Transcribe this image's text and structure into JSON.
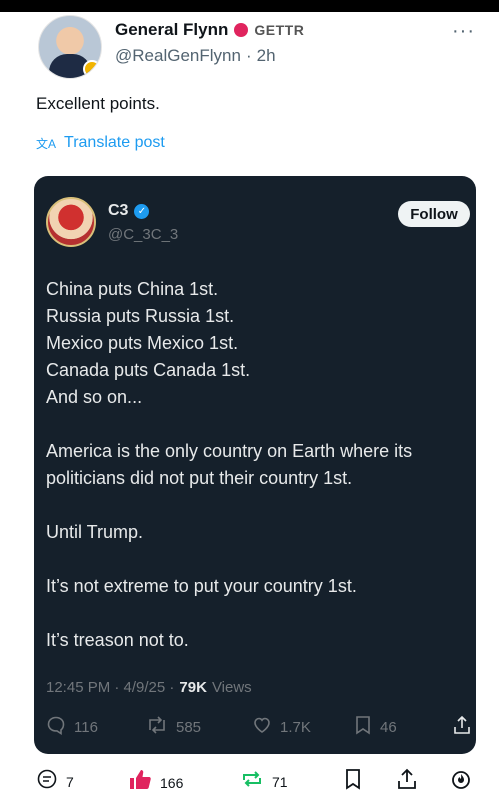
{
  "author": {
    "display_name": "General Flynn",
    "platform_label": "GETTR",
    "handle": "@RealGenFlynn",
    "separator": "·",
    "time": "2h"
  },
  "post": {
    "text": "Excellent points.",
    "translate_label": "Translate post"
  },
  "quoted": {
    "display_name": "C3",
    "handle": "@C_3C_3",
    "follow_label": "Follow",
    "lines": [
      "China puts China 1st.",
      "Russia puts Russia 1st.",
      "Mexico puts Mexico 1st.",
      "Canada puts Canada 1st.",
      "And so on...",
      "",
      "America is the only country on Earth where its",
      "politicians did not put their country 1st.",
      "",
      "Until Trump.",
      "",
      "It’s not extreme to put your country 1st.",
      "",
      "It’s treason not to."
    ],
    "timestamp": "12:45 PM · 4/9/25 ·",
    "views_count": "79K",
    "views_label": "Views",
    "stats": {
      "replies": "116",
      "reposts": "585",
      "likes": "1.7K",
      "bookmarks": "46"
    }
  },
  "bottom": {
    "comments": "7",
    "likes": "166",
    "reposts": "71"
  },
  "colors": {
    "card_bg": "#15202b",
    "accent_blue": "#1d9bf0",
    "like_red": "#e0245e",
    "repost_green": "#17bf63"
  }
}
